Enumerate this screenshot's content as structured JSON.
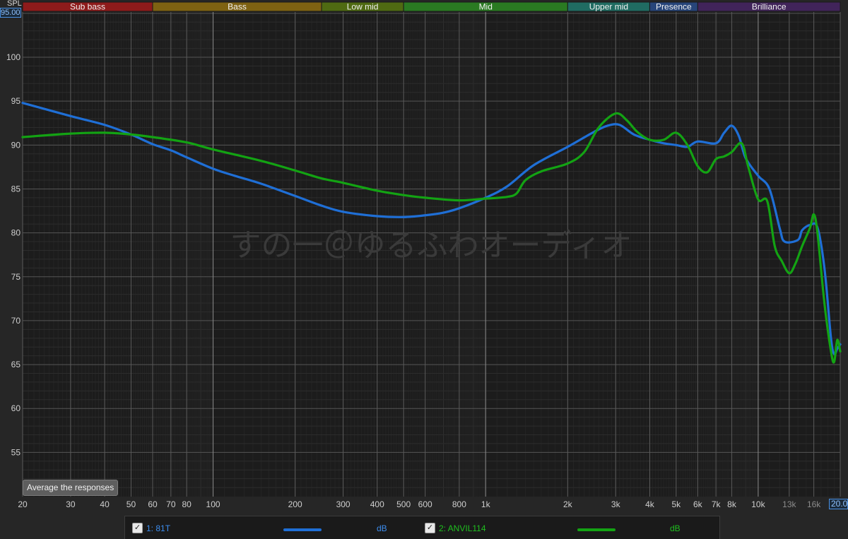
{
  "colors": {
    "background": "#262626",
    "plot_bg": "#1c1c1c",
    "series1": "#1f6fd6",
    "series2": "#13a313",
    "grid_major": "#575757",
    "grid_minor": "#303030"
  },
  "axis": {
    "y_label": "SPL",
    "y_top_value": "95.00",
    "x_right_value": "20.00"
  },
  "button": {
    "average_label": "Average the responses"
  },
  "bands": [
    {
      "name": "Sub bass",
      "from": 20,
      "to": 60,
      "color": "#8e1b1b"
    },
    {
      "name": "Bass",
      "from": 60,
      "to": 250,
      "color": "#7e6212"
    },
    {
      "name": "Low mid",
      "from": 250,
      "to": 500,
      "color": "#4f6a12"
    },
    {
      "name": "Mid",
      "from": 500,
      "to": 2000,
      "color": "#2a7a22"
    },
    {
      "name": "Upper mid",
      "from": 2000,
      "to": 4000,
      "color": "#206c62"
    },
    {
      "name": "Presence",
      "from": 4000,
      "to": 6000,
      "color": "#27457a"
    },
    {
      "name": "Brilliance",
      "from": 6000,
      "to": 20000,
      "color": "#41245a"
    }
  ],
  "watermark": "すの一＠ゆるふわオーディオ",
  "legend": [
    {
      "label": "1: 81T",
      "unit": "dB",
      "color": "#1f6fd6",
      "checked": "✓"
    },
    {
      "label": "2: ANVIL114",
      "unit": "dB",
      "color": "#13a313",
      "checked": "✓"
    }
  ],
  "chart_data": {
    "type": "line",
    "xlabel": "",
    "ylabel": "SPL",
    "x_scale": "log",
    "xlim": [
      20,
      20000
    ],
    "ylim": [
      50,
      105
    ],
    "grid": true,
    "y_ticks": [
      100,
      95,
      90,
      85,
      80,
      75,
      70,
      65,
      60,
      55
    ],
    "x_ticks": [
      {
        "v": 20,
        "t": "20"
      },
      {
        "v": 30,
        "t": "30"
      },
      {
        "v": 40,
        "t": "40"
      },
      {
        "v": 50,
        "t": "50"
      },
      {
        "v": 60,
        "t": "60"
      },
      {
        "v": 70,
        "t": "70"
      },
      {
        "v": 80,
        "t": "80"
      },
      {
        "v": 100,
        "t": "100"
      },
      {
        "v": 200,
        "t": "200"
      },
      {
        "v": 300,
        "t": "300"
      },
      {
        "v": 400,
        "t": "400"
      },
      {
        "v": 500,
        "t": "500"
      },
      {
        "v": 600,
        "t": "600"
      },
      {
        "v": 800,
        "t": "800"
      },
      {
        "v": 1000,
        "t": "1k"
      },
      {
        "v": 2000,
        "t": "2k"
      },
      {
        "v": 3000,
        "t": "3k"
      },
      {
        "v": 4000,
        "t": "4k"
      },
      {
        "v": 5000,
        "t": "5k"
      },
      {
        "v": 6000,
        "t": "6k"
      },
      {
        "v": 7000,
        "t": "7k"
      },
      {
        "v": 8000,
        "t": "8k"
      },
      {
        "v": 10000,
        "t": "10k"
      },
      {
        "v": 13000,
        "t": "13k",
        "dim": true
      },
      {
        "v": 16000,
        "t": "16k",
        "dim": true
      }
    ],
    "series": [
      {
        "name": "1: 81T",
        "color": "#1f6fd6",
        "points": [
          [
            20,
            94.8
          ],
          [
            30,
            93.3
          ],
          [
            40,
            92.3
          ],
          [
            50,
            91.2
          ],
          [
            60,
            90.1
          ],
          [
            70,
            89.4
          ],
          [
            80,
            88.6
          ],
          [
            100,
            87.3
          ],
          [
            120,
            86.5
          ],
          [
            150,
            85.6
          ],
          [
            200,
            84.2
          ],
          [
            250,
            83.1
          ],
          [
            300,
            82.4
          ],
          [
            400,
            81.9
          ],
          [
            500,
            81.8
          ],
          [
            600,
            82.0
          ],
          [
            700,
            82.3
          ],
          [
            800,
            82.8
          ],
          [
            1000,
            84.0
          ],
          [
            1200,
            85.3
          ],
          [
            1500,
            87.7
          ],
          [
            2000,
            89.8
          ],
          [
            2500,
            91.5
          ],
          [
            2800,
            92.2
          ],
          [
            3100,
            92.3
          ],
          [
            3500,
            91.2
          ],
          [
            4000,
            90.6
          ],
          [
            4500,
            90.2
          ],
          [
            5000,
            90.0
          ],
          [
            5500,
            89.8
          ],
          [
            6000,
            90.4
          ],
          [
            7000,
            90.2
          ],
          [
            7500,
            91.4
          ],
          [
            8000,
            92.2
          ],
          [
            8500,
            91.0
          ],
          [
            9000,
            88.5
          ],
          [
            10000,
            86.5
          ],
          [
            11000,
            85.0
          ],
          [
            12000,
            80.5
          ],
          [
            12500,
            79.0
          ],
          [
            14000,
            79.2
          ],
          [
            14500,
            80.3
          ],
          [
            15500,
            80.9
          ],
          [
            16500,
            80.6
          ],
          [
            17500,
            76.0
          ],
          [
            18500,
            68.0
          ],
          [
            19000,
            66.2
          ],
          [
            19500,
            66.8
          ],
          [
            20000,
            67.3
          ]
        ]
      },
      {
        "name": "2: ANVIL114",
        "color": "#13a313",
        "points": [
          [
            20,
            90.9
          ],
          [
            30,
            91.3
          ],
          [
            40,
            91.4
          ],
          [
            50,
            91.2
          ],
          [
            60,
            90.9
          ],
          [
            80,
            90.3
          ],
          [
            100,
            89.5
          ],
          [
            150,
            88.2
          ],
          [
            200,
            87.1
          ],
          [
            250,
            86.2
          ],
          [
            300,
            85.7
          ],
          [
            400,
            84.8
          ],
          [
            500,
            84.3
          ],
          [
            600,
            84.0
          ],
          [
            800,
            83.7
          ],
          [
            1000,
            83.9
          ],
          [
            1200,
            84.1
          ],
          [
            1300,
            84.5
          ],
          [
            1400,
            86.0
          ],
          [
            1600,
            87.0
          ],
          [
            2000,
            87.9
          ],
          [
            2300,
            89.2
          ],
          [
            2600,
            92.0
          ],
          [
            3000,
            93.6
          ],
          [
            3300,
            92.8
          ],
          [
            3600,
            91.5
          ],
          [
            4000,
            90.6
          ],
          [
            4500,
            90.6
          ],
          [
            5000,
            91.4
          ],
          [
            5500,
            90.0
          ],
          [
            6000,
            87.6
          ],
          [
            6500,
            86.9
          ],
          [
            7000,
            88.4
          ],
          [
            7500,
            88.7
          ],
          [
            8000,
            89.2
          ],
          [
            8700,
            90.2
          ],
          [
            9200,
            87.5
          ],
          [
            10000,
            83.8
          ],
          [
            10800,
            83.6
          ],
          [
            11500,
            78.5
          ],
          [
            12200,
            76.8
          ],
          [
            13000,
            75.4
          ],
          [
            13700,
            76.5
          ],
          [
            14500,
            78.5
          ],
          [
            15500,
            80.6
          ],
          [
            16000,
            82.1
          ],
          [
            16500,
            80.0
          ],
          [
            17500,
            72.0
          ],
          [
            18500,
            66.5
          ],
          [
            19000,
            65.3
          ],
          [
            19500,
            67.8
          ],
          [
            20000,
            66.5
          ]
        ]
      }
    ]
  }
}
